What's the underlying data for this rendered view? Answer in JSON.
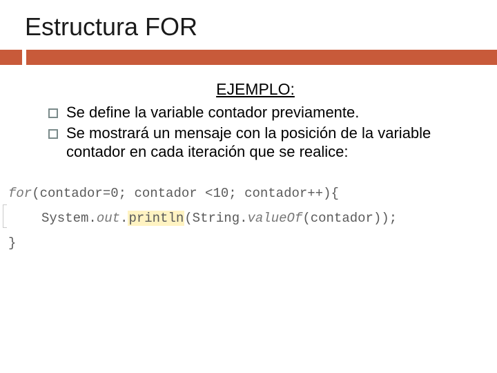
{
  "title": "Estructura FOR",
  "ejemplo_label": "EJEMPLO:",
  "bullets": [
    "Se define la variable contador previamente.",
    "Se mostrará un mensaje con la posición de la variable contador en cada iteración que se realice:"
  ],
  "code": {
    "kw_for": "for",
    "paren_open": "(contador=0; contador <10; contador++){",
    "sys": "System.",
    "out": "out",
    "dot1": ".",
    "println": "println",
    "paren2": "(String.",
    "valueof": "valueOf",
    "rest": "(contador));",
    "close": "}"
  }
}
